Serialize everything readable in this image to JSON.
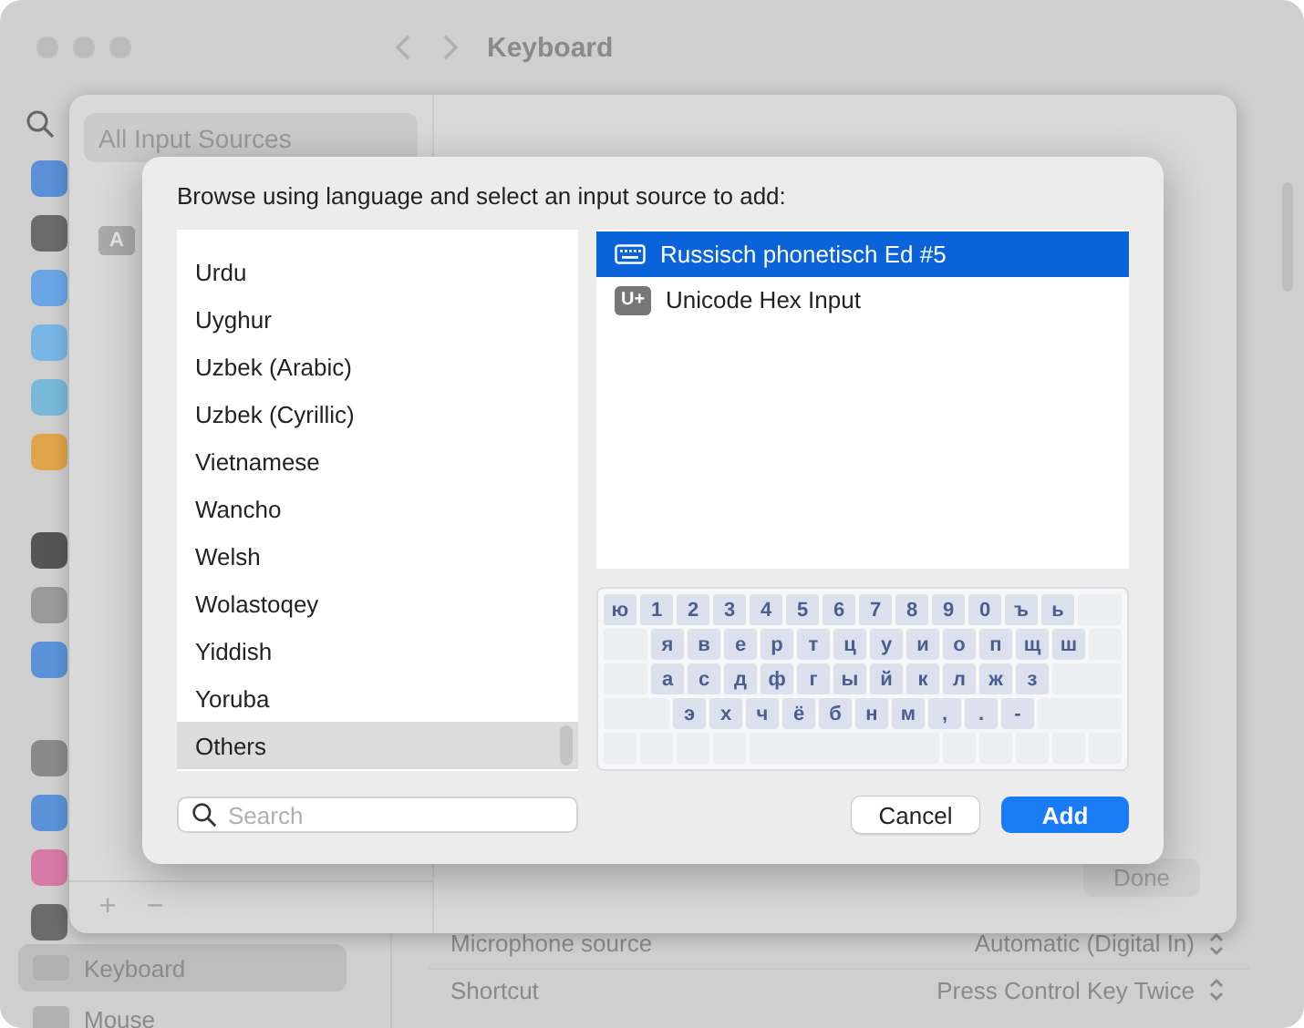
{
  "window": {
    "title": "Keyboard"
  },
  "sidebar": {
    "icons": [
      {
        "color": "#5b8fd6"
      },
      {
        "color": "#6b6b6b"
      },
      {
        "color": "#6aa6e6"
      },
      {
        "color": "#79b6e6"
      },
      {
        "color": "#78b8d8"
      },
      {
        "color": "#e0a54a"
      },
      {
        "color": "#555555"
      },
      {
        "color": "#9a9a9a"
      },
      {
        "color": "#5b93d8"
      },
      {
        "color": "#8a8a8a"
      },
      {
        "color": "#5b93d8"
      },
      {
        "color": "#d87aa8"
      },
      {
        "color": "#6b6b6b"
      }
    ],
    "items": [
      {
        "label": "Keyboard",
        "selected": true
      },
      {
        "label": "Mouse",
        "selected": false
      }
    ]
  },
  "settings": [
    {
      "label": "Microphone source",
      "value": "Automatic (Digital In)"
    },
    {
      "label": "Shortcut",
      "value": "Press Control Key Twice"
    }
  ],
  "sheet": {
    "sources": [
      {
        "label": "All Input Sources",
        "selected": true
      }
    ],
    "badge": "A",
    "add": "+",
    "remove": "−",
    "done": "Done"
  },
  "dialog": {
    "prompt": "Browse using language and select an input source to add:",
    "languages": [
      {
        "label": "Urdu",
        "selected": false
      },
      {
        "label": "Uyghur",
        "selected": false
      },
      {
        "label": "Uzbek (Arabic)",
        "selected": false
      },
      {
        "label": "Uzbek (Cyrillic)",
        "selected": false
      },
      {
        "label": "Vietnamese",
        "selected": false
      },
      {
        "label": "Wancho",
        "selected": false
      },
      {
        "label": "Welsh",
        "selected": false
      },
      {
        "label": "Wolastoqey",
        "selected": false
      },
      {
        "label": "Yiddish",
        "selected": false
      },
      {
        "label": "Yoruba",
        "selected": false
      },
      {
        "label": "Others",
        "selected": true
      }
    ],
    "input_sources": [
      {
        "kind": "keyboard",
        "label": "Russisch phonetisch Ed #5",
        "selected": true
      },
      {
        "kind": "badge",
        "badge": "U+",
        "label": "Unicode Hex Input",
        "selected": false
      }
    ],
    "keyboard": {
      "rows": [
        [
          "ю",
          "1",
          "2",
          "3",
          "4",
          "5",
          "6",
          "7",
          "8",
          "9",
          "0",
          "ъ",
          "ь"
        ],
        [
          "я",
          "в",
          "е",
          "р",
          "т",
          "ц",
          "у",
          "и",
          "о",
          "п",
          "щ",
          "ш"
        ],
        [
          "а",
          "с",
          "д",
          "ф",
          "г",
          "ы",
          "й",
          "к",
          "л",
          "ж",
          "з"
        ],
        [
          "э",
          "х",
          "ч",
          "ё",
          "б",
          "н",
          "м",
          ",",
          ".",
          "-"
        ]
      ]
    },
    "search": {
      "placeholder": "Search"
    },
    "buttons": [
      {
        "label": "Cancel",
        "kind": "secondary"
      },
      {
        "label": "Add",
        "kind": "primary"
      }
    ]
  }
}
